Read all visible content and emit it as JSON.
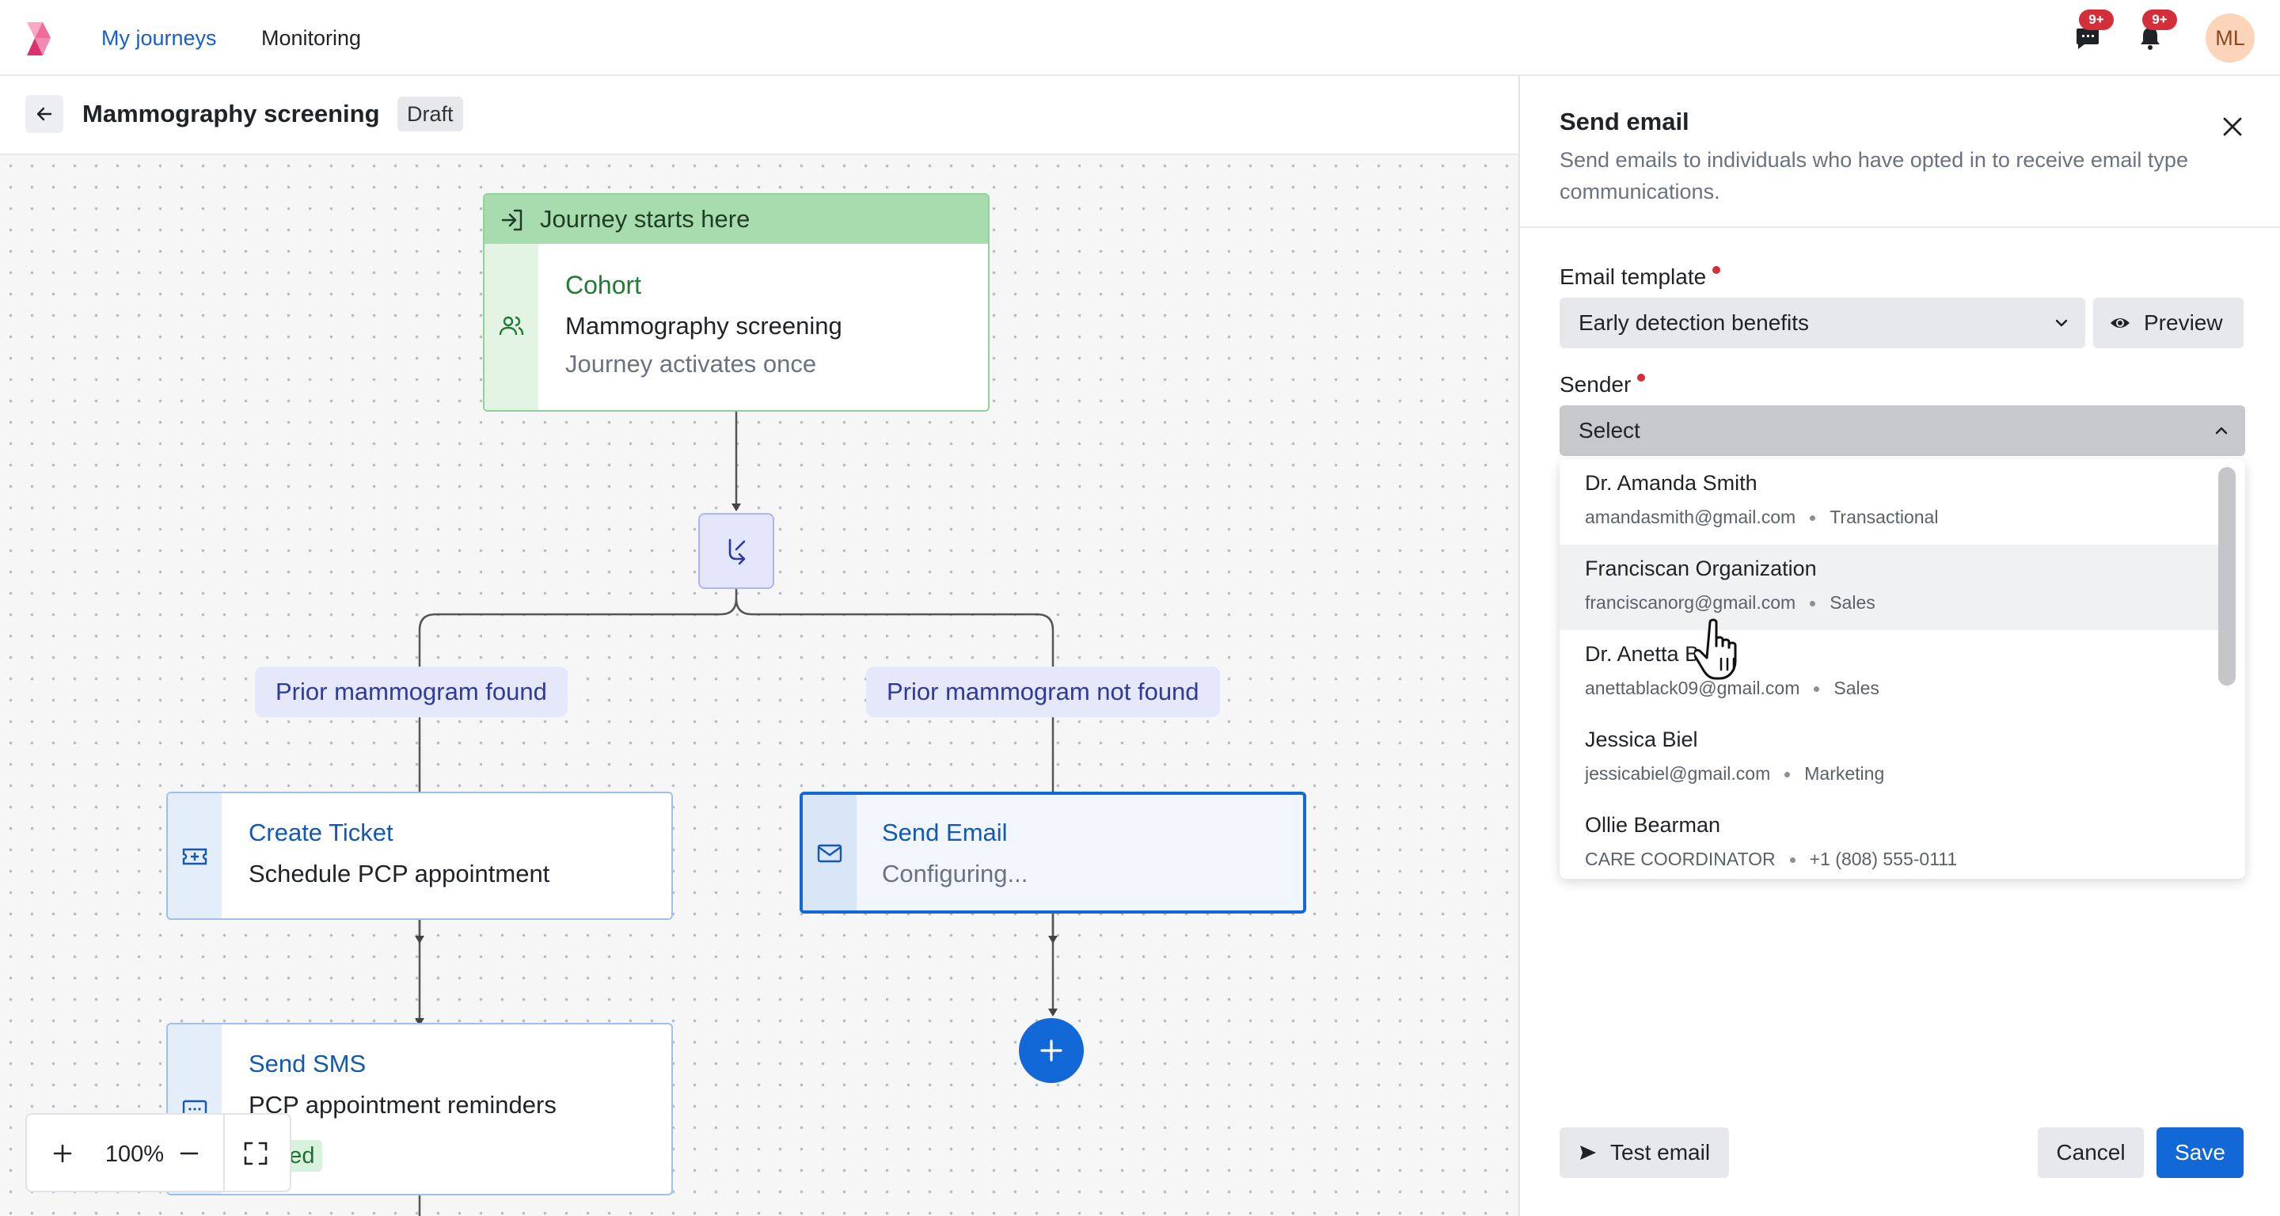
{
  "nav": {
    "links": [
      "My journeys",
      "Monitoring"
    ],
    "chat_badge": "9+",
    "bell_badge": "9+",
    "avatar_initials": "ML"
  },
  "header": {
    "title": "Mammography screening",
    "status": "Draft"
  },
  "canvas": {
    "start": {
      "header": "Journey starts here",
      "type": "Cohort",
      "name": "Mammography screening",
      "detail": "Journey activates once"
    },
    "branches": [
      "Prior mammogram found",
      "Prior mammogram not found"
    ],
    "nodes": [
      {
        "type": "Create Ticket",
        "desc": "Schedule PCP appointment"
      },
      {
        "type": "Send Email",
        "desc": "Configuring..."
      },
      {
        "type": "Send SMS",
        "desc": "PCP appointment reminders",
        "tag": "Tested"
      }
    ],
    "zoom": "100%"
  },
  "panel": {
    "title": "Send email",
    "description": "Send emails to individuals who have opted in to receive email type communications.",
    "template_label": "Email template",
    "template_value": "Early detection benefits",
    "preview_label": "Preview",
    "sender_label": "Sender",
    "sender_value": "Select",
    "options": [
      {
        "name": "Dr. Amanda Smith",
        "contact": "amandasmith@gmail.com",
        "category": "Transactional"
      },
      {
        "name": "Franciscan Organization",
        "contact": "franciscanorg@gmail.com",
        "category": "Sales"
      },
      {
        "name": "Dr. Anetta B",
        "contact": "anettablack09@gmail.com",
        "category": "Sales"
      },
      {
        "name": "Jessica Biel",
        "contact": "jessicabiel@gmail.com",
        "category": "Marketing"
      },
      {
        "name": "Ollie Bearman",
        "contact": "CARE COORDINATOR",
        "category": "+1 (808) 555-0111"
      }
    ],
    "test_email_label": "Test email",
    "cancel_label": "Cancel",
    "save_label": "Save"
  },
  "colors": {
    "accent": "#1268d6",
    "nav_active": "#1560c9",
    "badge": "#d32f3a",
    "start_header": "#a8dcae",
    "branch_label": "#e5e7fb"
  }
}
